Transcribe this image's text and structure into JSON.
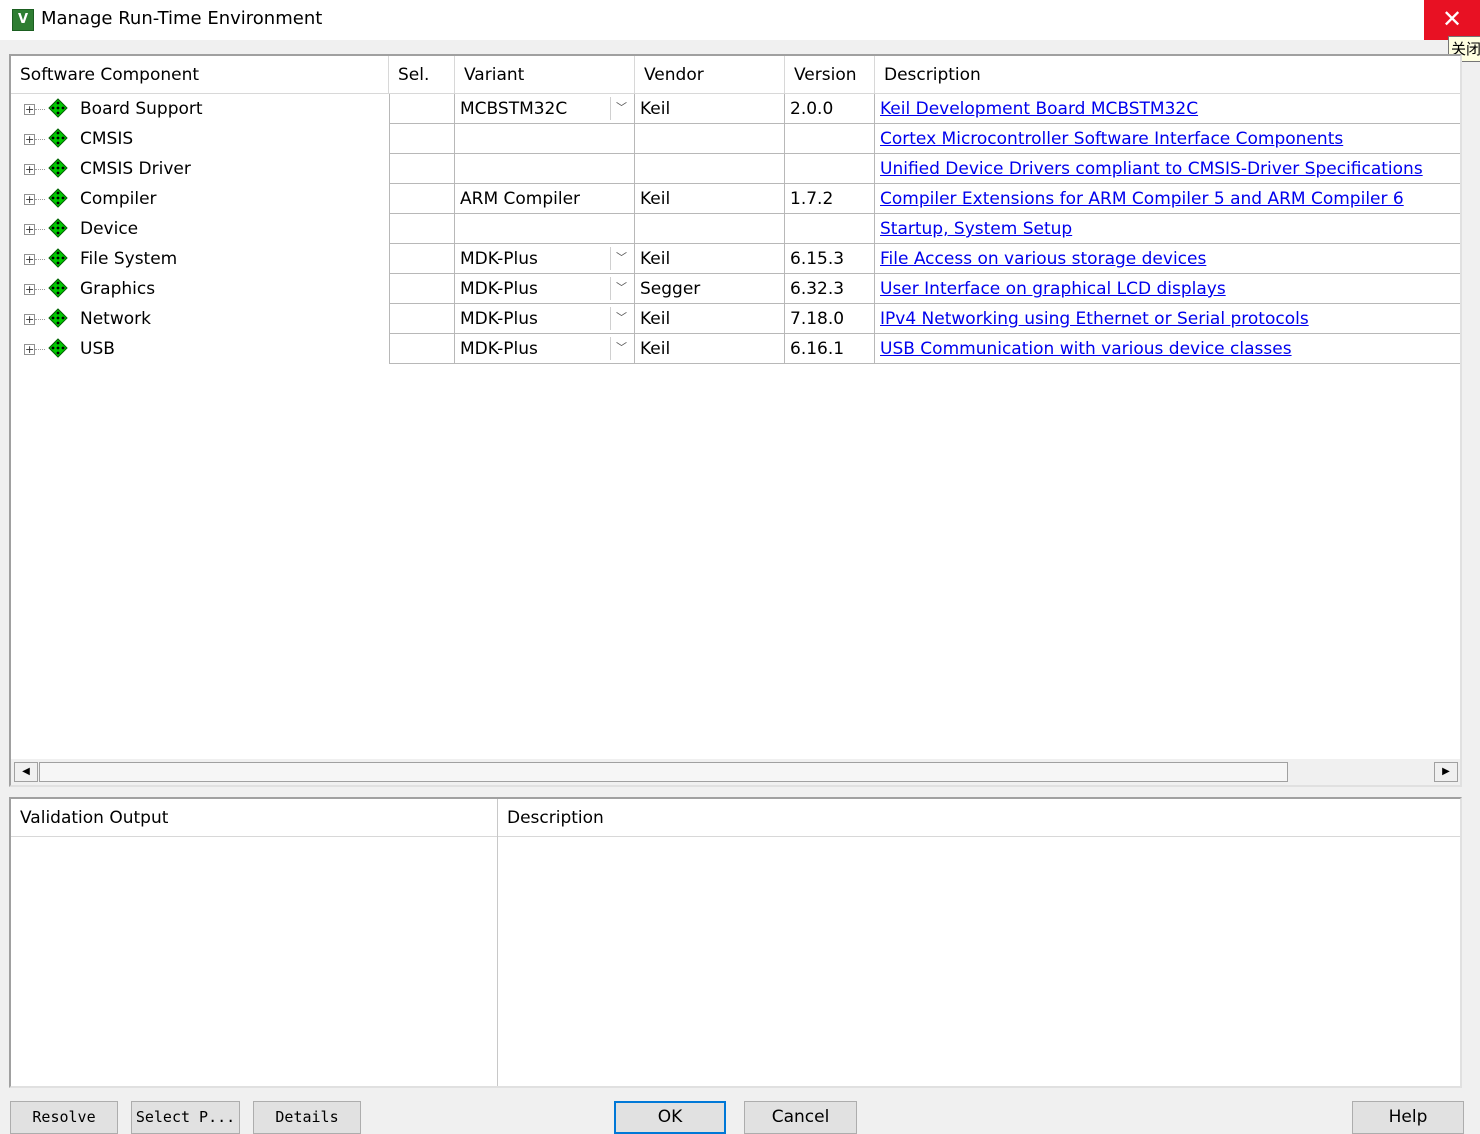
{
  "window": {
    "title": "Manage Run-Time Environment",
    "close_tooltip": "关闭"
  },
  "component_table": {
    "columns": [
      "Software Component",
      "Sel.",
      "Variant",
      "Vendor",
      "Version",
      "Description"
    ],
    "rows": [
      {
        "name": "Board Support",
        "variant": "MCBSTM32C",
        "has_dropdown": true,
        "vendor": "Keil",
        "version": "2.0.0",
        "description": "Keil Development Board MCBSTM32C"
      },
      {
        "name": "CMSIS",
        "variant": "",
        "has_dropdown": false,
        "vendor": "",
        "version": "",
        "description": "Cortex Microcontroller Software Interface Components"
      },
      {
        "name": "CMSIS Driver",
        "variant": "",
        "has_dropdown": false,
        "vendor": "",
        "version": "",
        "description": "Unified Device Drivers compliant to CMSIS-Driver Specifications"
      },
      {
        "name": "Compiler",
        "variant": "ARM Compiler",
        "has_dropdown": false,
        "vendor": "Keil",
        "version": "1.7.2",
        "description": "Compiler Extensions for ARM Compiler 5 and ARM Compiler 6"
      },
      {
        "name": "Device",
        "variant": "",
        "has_dropdown": false,
        "vendor": "",
        "version": "",
        "description": "Startup, System Setup"
      },
      {
        "name": "File System",
        "variant": "MDK-Plus",
        "has_dropdown": true,
        "vendor": "Keil",
        "version": "6.15.3",
        "description": "File Access on various storage devices"
      },
      {
        "name": "Graphics",
        "variant": "MDK-Plus",
        "has_dropdown": true,
        "vendor": "Segger",
        "version": "6.32.3",
        "description": "User Interface on graphical LCD displays"
      },
      {
        "name": "Network",
        "variant": "MDK-Plus",
        "has_dropdown": true,
        "vendor": "Keil",
        "version": "7.18.0",
        "description": "IPv4 Networking using Ethernet or Serial protocols"
      },
      {
        "name": "USB",
        "variant": "MDK-Plus",
        "has_dropdown": true,
        "vendor": "Keil",
        "version": "6.16.1",
        "description": "USB Communication with various device classes"
      }
    ]
  },
  "validation": {
    "columns": [
      "Validation Output",
      "Description"
    ]
  },
  "buttons": {
    "resolve": "Resolve",
    "select_packs": "Select P...",
    "details": "Details",
    "ok": "OK",
    "cancel": "Cancel",
    "help": "Help"
  },
  "colors": {
    "link": "#0000ee",
    "close_button": "#e81123",
    "component_icon": "#00c800"
  }
}
